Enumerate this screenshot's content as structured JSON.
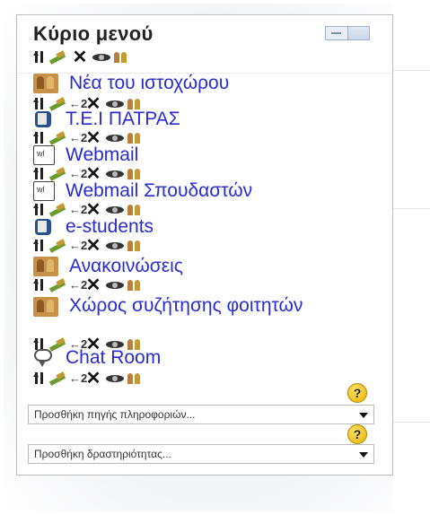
{
  "block": {
    "title": "Κύριο μενού"
  },
  "items": [
    {
      "label": "Νέα του ιστοχώρου",
      "icon": "forum-icon"
    },
    {
      "label": "T.E.I ΠΑΤΡΑΣ",
      "icon": "resource-icon"
    },
    {
      "label": "Webmail",
      "icon": "page-icon"
    },
    {
      "label": "Webmail Σπουδαστών",
      "icon": "page-icon"
    },
    {
      "label": "e-students",
      "icon": "resource-icon"
    },
    {
      "label": "Ανακοινώσεις",
      "icon": "forum-icon"
    },
    {
      "label": "Χώρος συζήτησης φοιτητών",
      "icon": "forum-icon"
    },
    {
      "label": "Chat Room",
      "icon": "chat-icon"
    }
  ],
  "controls": {
    "decrease_indent": "←2"
  },
  "help": {
    "symbol": "?"
  },
  "add_resource": {
    "placeholder": "Προσθήκη πηγής πληροφοριών..."
  },
  "add_activity": {
    "placeholder": "Προσθήκη δραστηριότητας..."
  }
}
